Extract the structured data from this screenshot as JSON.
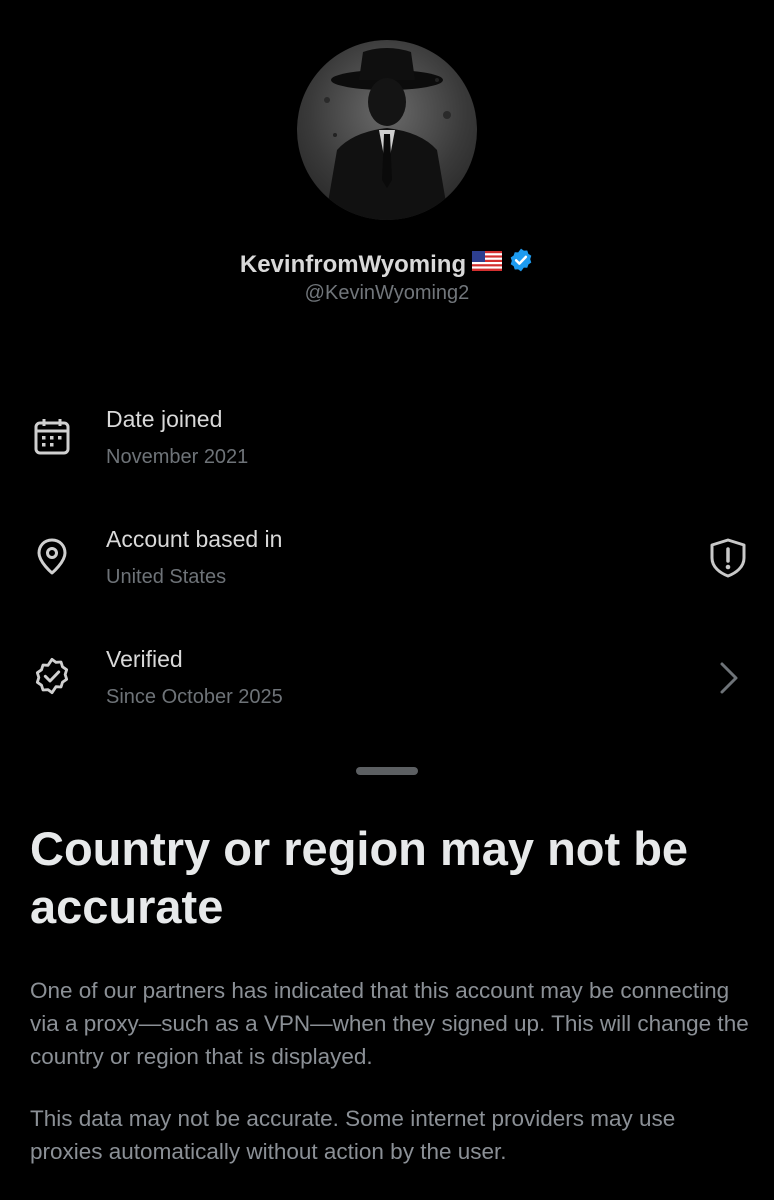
{
  "profile": {
    "display_name": "KevinfromWyoming",
    "flag_icon": "us-flag-icon",
    "verified_icon": "verified-badge-icon",
    "verified_color": "#1d9bf0",
    "handle": "@KevinWyoming2"
  },
  "info_rows": [
    {
      "icon": "calendar-icon",
      "title": "Date joined",
      "value": "November 2021"
    },
    {
      "icon": "location-pin-icon",
      "title": "Account based in",
      "value": "United States",
      "action_icon": "shield-alert-icon"
    },
    {
      "icon": "verified-outline-icon",
      "title": "Verified",
      "value": "Since October 2025",
      "action_icon": "chevron-right-icon"
    }
  ],
  "sheet": {
    "title": "Country or region may not be accurate",
    "paragraph1": "One of our partners has indicated that this account may be connecting via a proxy—such as a VPN—when they signed up. This will change the country or region that is displayed.",
    "paragraph2": "This data may not be accurate. Some internet providers may use proxies automatically without action by the user."
  },
  "colors": {
    "background": "#000000",
    "primary_text": "#e7e9ea",
    "secondary_text": "#71767b",
    "accent": "#1d9bf0"
  }
}
